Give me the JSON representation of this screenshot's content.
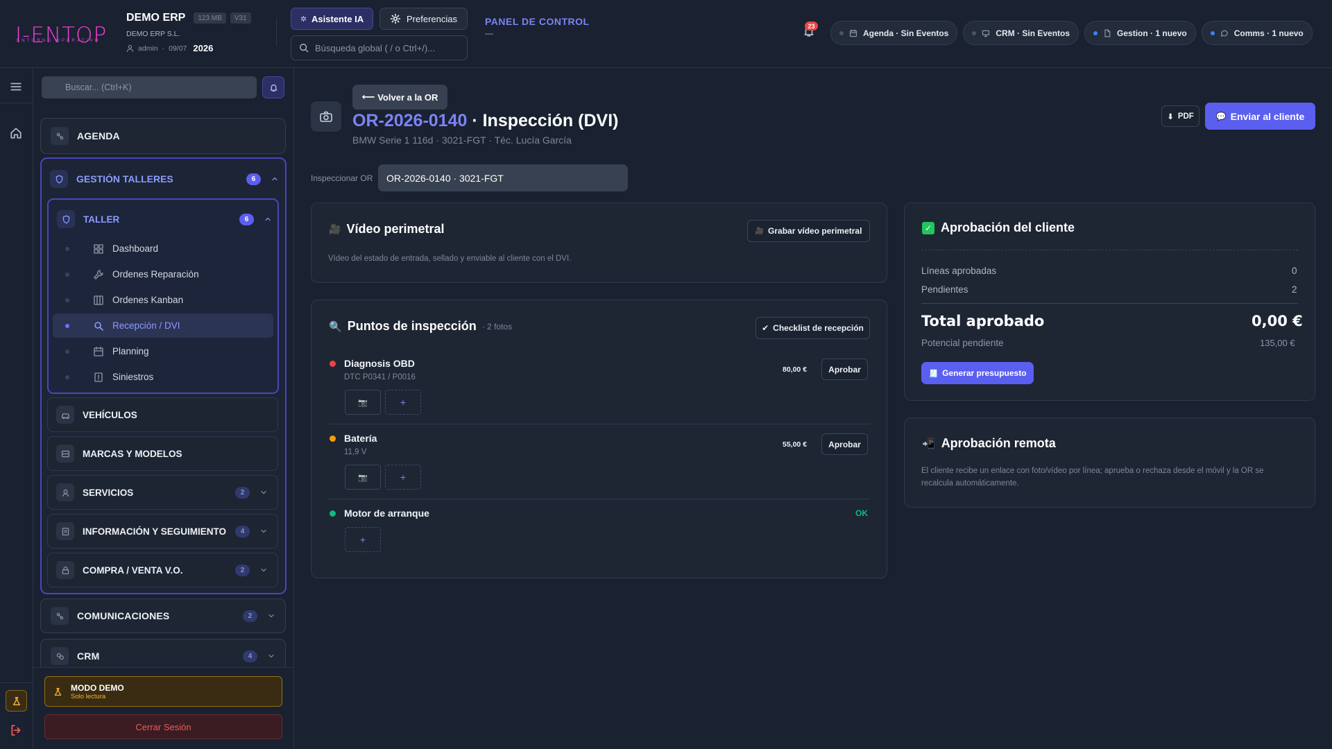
{
  "header": {
    "logo": "I-ENTOP",
    "logo_sub": "ENTORNO OPERATIVO",
    "company": "DEMO ERP",
    "mem_badge": "123 MB",
    "ver_badge": "V31",
    "company_legal": "DEMO ERP S.L.",
    "user": "admin",
    "date": "09/07",
    "year": "2026",
    "ai_button": "Asistente IA",
    "prefs_button": "Preferencias",
    "search_placeholder": "Búsqueda global ( / o Ctrl+/)...",
    "panel_title": "PANEL DE CONTROL",
    "panel_sub": "—",
    "notif_count": "23",
    "pills": [
      {
        "label": "Agenda · Sin Eventos",
        "icon": "calendar-icon"
      },
      {
        "label": "CRM · Sin Eventos",
        "icon": "monitor-icon"
      },
      {
        "label": "Gestion · 1 nuevo",
        "icon": "document-icon"
      },
      {
        "label": "Comms · 1 nuevo",
        "icon": "chat-icon"
      }
    ]
  },
  "sidebar": {
    "search_placeholder": "Buscar... (Ctrl+K)",
    "agenda": "AGENDA",
    "gestion": {
      "label": "GESTIÓN TALLERES",
      "count": "6"
    },
    "taller": {
      "label": "TALLER",
      "count": "6"
    },
    "taller_items": [
      {
        "label": "Dashboard"
      },
      {
        "label": "Ordenes Reparación"
      },
      {
        "label": "Ordenes Kanban"
      },
      {
        "label": "Recepción / DVI"
      },
      {
        "label": "Planning"
      },
      {
        "label": "Siniestros"
      }
    ],
    "vehiculos": "VEHÍCULOS",
    "marcas": "MARCAS Y MODELOS",
    "servicios": {
      "label": "SERVICIOS",
      "count": "2"
    },
    "info": {
      "label": "INFORMACIÓN Y SEGUIMIENTO",
      "count": "4"
    },
    "compra": {
      "label": "COMPRA / VENTA V.O.",
      "count": "2"
    },
    "comunicaciones": {
      "label": "COMUNICACIONES",
      "count": "2"
    },
    "crm": {
      "label": "CRM",
      "count": "4"
    },
    "demo_title": "MODO DEMO",
    "demo_sub": "Solo lectura",
    "logout": "Cerrar Sesión"
  },
  "main": {
    "back_button": "Volver a la OR",
    "or_code": "OR-2026-0140",
    "title_suffix": " · Inspección (DVI)",
    "subtitle": "BMW Serie 1 116d · 3021-FGT · Téc. Lucía García",
    "pdf_button": "PDF",
    "send_button": "Enviar al cliente",
    "inspect_label": "Inspeccionar OR",
    "inspect_value": "OR-2026-0140 · 3021-FGT",
    "video": {
      "title": "Vídeo perimetral",
      "record_button": "Grabar vídeo perimetral",
      "desc": "Vídeo del estado de entrada, sellado y enviable al cliente con el DVI."
    },
    "points": {
      "title": "Puntos de inspección",
      "photos": "· 2 fotos",
      "checklist_button": "Checklist de recepción",
      "items": [
        {
          "name": "Diagnosis OBD",
          "detail": "DTC P0341 / P0016",
          "price": "80,00 €",
          "action": "Aprobar",
          "color": "#ef4444"
        },
        {
          "name": "Batería",
          "detail": "11,9 V",
          "price": "55,00 €",
          "action": "Aprobar",
          "color": "#f59e0b"
        },
        {
          "name": "Motor de arranque",
          "detail": "",
          "status": "OK",
          "color": "#10b981"
        }
      ]
    },
    "approval": {
      "title": "Aprobación del cliente",
      "approved_label": "Líneas aprobadas",
      "approved_value": "0",
      "pending_label": "Pendientes",
      "pending_value": "2",
      "total_label": "Total aprobado",
      "total_value": "0,00 €",
      "potential_label": "Potencial pendiente",
      "potential_value": "135,00 €",
      "budget_button": "Generar presupuesto"
    },
    "remote": {
      "title": "Aprobación remota",
      "desc": "El cliente recibe un enlace con foto/vídeo por línea; aprueba o rechaza desde el móvil y la OR se recalcula automáticamente."
    }
  },
  "colors": {
    "accent": "#5b5ff0",
    "accent_text": "#7b84f5",
    "logo": "#ea3fd3",
    "danger": "#ef4444",
    "warning": "#f59e0b",
    "ok": "#10b981"
  }
}
